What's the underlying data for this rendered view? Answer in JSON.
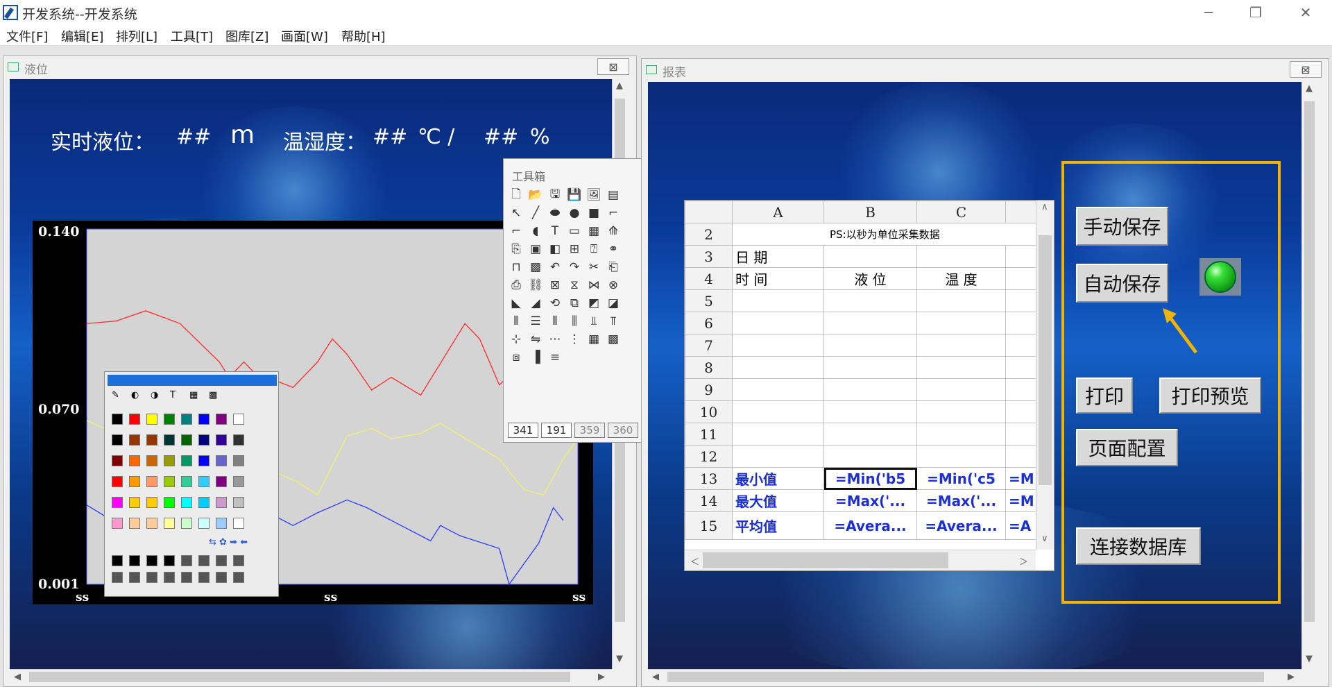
{
  "app": {
    "title": "开发系统--开发系统",
    "window_controls": {
      "minimize": "─",
      "restore": "❐",
      "close": "✕"
    }
  },
  "menu": {
    "items": [
      "文件[F]",
      "编辑[E]",
      "排列[L]",
      "工具[T]",
      "图库[Z]",
      "画面[W]",
      "帮助[H]"
    ]
  },
  "left_window": {
    "title": "液位",
    "close_symbol": "⊠",
    "hud": {
      "level_label": "实时液位：",
      "level_value": "##",
      "level_unit": "m",
      "temp_label": "温湿度：",
      "temp_value": "##",
      "temp_unit": "℃ /",
      "hum_value": "##",
      "hum_unit": "%"
    }
  },
  "chart_data": {
    "type": "line",
    "title": "",
    "xlabel": "",
    "ylabel": "",
    "y_tick_labels": [
      "0.140",
      "0.070",
      "0.001"
    ],
    "x_tick_labels": [
      "ss",
      "ss",
      "ss"
    ],
    "ylim": [
      0.001,
      0.14
    ],
    "xlim": [
      0,
      100
    ],
    "grid": false,
    "series": [
      {
        "color": "#ff2a2a",
        "x": [
          0,
          6,
          12,
          19,
          27,
          29,
          32,
          34,
          42,
          47,
          50,
          53,
          58,
          62,
          68,
          77,
          80,
          84,
          88,
          92,
          96,
          100
        ],
        "y": [
          0.103,
          0.104,
          0.108,
          0.103,
          0.088,
          0.082,
          0.088,
          0.084,
          0.078,
          0.088,
          0.097,
          0.091,
          0.077,
          0.082,
          0.075,
          0.103,
          0.097,
          0.079,
          0.086,
          0.087,
          0.09,
          0.091
        ]
      },
      {
        "color": "#f3f36a",
        "x": [
          0,
          6,
          12,
          19,
          27,
          32,
          36,
          43,
          47,
          53,
          58,
          62,
          68,
          72,
          78,
          84,
          89,
          93,
          97,
          100
        ],
        "y": [
          0.065,
          0.06,
          0.058,
          0.052,
          0.047,
          0.054,
          0.047,
          0.041,
          0.036,
          0.059,
          0.062,
          0.058,
          0.06,
          0.064,
          0.057,
          0.05,
          0.038,
          0.036,
          0.05,
          0.058
        ]
      },
      {
        "color": "#2a3cff",
        "x": [
          0,
          6,
          12,
          19,
          27,
          32,
          36,
          42,
          47,
          53,
          57,
          64,
          70,
          72,
          76,
          84,
          86,
          92,
          95,
          97
        ],
        "y": [
          0.032,
          0.025,
          0.021,
          0.02,
          0.022,
          0.025,
          0.03,
          0.024,
          0.029,
          0.034,
          0.031,
          0.024,
          0.018,
          0.024,
          0.02,
          0.015,
          0.001,
          0.017,
          0.031,
          0.026
        ]
      }
    ]
  },
  "toolbox": {
    "title": "工具箱",
    "coords": [
      "341",
      "191",
      "359",
      "360"
    ]
  },
  "palette": {
    "row_colors": [
      [
        "#000000",
        "#ff0000",
        "#ffff00",
        "#008000",
        "#008080",
        "#0000ff",
        "#800080",
        "#ffffff"
      ],
      [
        "#000000",
        "#993300",
        "#993300",
        "#003333",
        "#006600",
        "#000080",
        "#330099",
        "#333333"
      ],
      [
        "#800000",
        "#ff6600",
        "#cc6600",
        "#999900",
        "#009966",
        "#0000ff",
        "#6666cc",
        "#808080"
      ],
      [
        "#ff0000",
        "#ff9900",
        "#ff9966",
        "#99cc00",
        "#33cc99",
        "#33ccff",
        "#800080",
        "#999999"
      ],
      [
        "#ff00ff",
        "#ffcc00",
        "#ffcc00",
        "#00ff00",
        "#00ffff",
        "#00ccff",
        "#cc99cc",
        "#c0c0c0"
      ],
      [
        "#ff99cc",
        "#ffcc99",
        "#ffcc99",
        "#ffff99",
        "#ccffcc",
        "#ccffff",
        "#99ccff",
        "#ffffff"
      ],
      [
        "#000000",
        "#000000",
        "#000000",
        "#000000",
        "#555555",
        "#555555",
        "#555555",
        "#555555"
      ],
      [
        "#555555",
        "#555555",
        "#555555",
        "#555555",
        "#555555",
        "#555555",
        "#555555",
        "#555555"
      ]
    ]
  },
  "right_window": {
    "title": "报表",
    "close_symbol": "⊠",
    "sheet": {
      "col_headers": [
        "A",
        "B",
        "C"
      ],
      "note": "PS:以秒为单位采集数据",
      "row_labels": [
        "2",
        "3",
        "4",
        "5",
        "6",
        "7",
        "8",
        "9",
        "10",
        "11",
        "12",
        "13",
        "14",
        "15"
      ],
      "date_label": "日 期",
      "time_label": "时 间",
      "col_b_header": "液 位",
      "col_c_header": "温 度",
      "min_label": "最小值",
      "max_label": "最大值",
      "avg_label": "平均值",
      "min_b": "=Min('b5",
      "min_c": "=Min('c5",
      "min_d": "=M",
      "max_b": "=Max('...",
      "max_c": "=Max('...",
      "max_d": "=M",
      "avg_b": "=Avera...",
      "avg_c": "=Avera...",
      "avg_d": "=A"
    },
    "buttons": {
      "manual_save": "手动保存",
      "auto_save": "自动保存",
      "print": "打印",
      "print_preview": "打印预览",
      "page_setup": "页面配置",
      "connect_db": "连接数据库"
    },
    "accent_color": "#f2b400",
    "led_color": "#39e23a"
  }
}
